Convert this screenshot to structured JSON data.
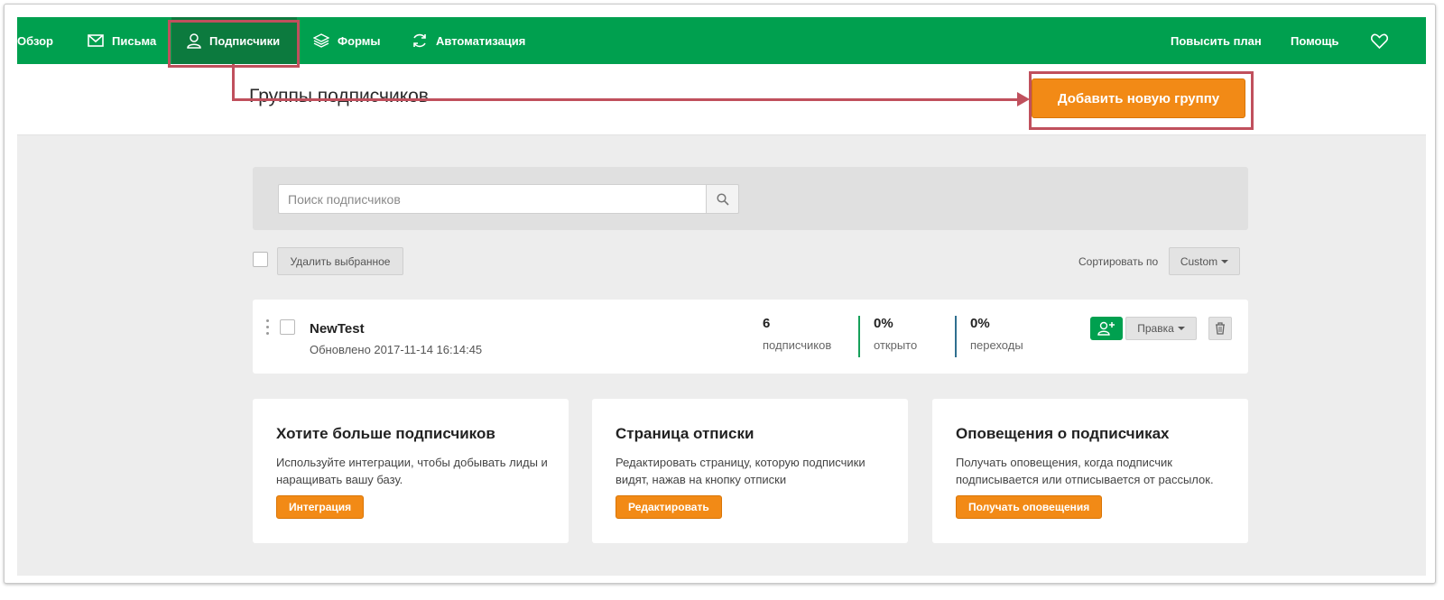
{
  "nav": {
    "overview": "Обзор",
    "letters": "Письма",
    "subscribers": "Подписчики",
    "forms": "Формы",
    "automation": "Автоматизация",
    "upgrade": "Повысить план",
    "help": "Помощь",
    "icons": [
      "mail-icon",
      "user-icon",
      "layers-icon",
      "refresh-icon",
      "heart-icon"
    ]
  },
  "header": {
    "title": "Группы подписчиков",
    "add_group": "Добавить новую группу"
  },
  "search": {
    "placeholder": "Поиск подписчиков"
  },
  "toolbar": {
    "delete_selected": "Удалить выбранное",
    "sort_label": "Сортировать по",
    "sort_value": "Custom"
  },
  "group": {
    "name": "NewTest",
    "updated": "Обновлено 2017-11-14 16:14:45",
    "subscribers_count": "6",
    "subscribers_label": "подписчиков",
    "opened_value": "0%",
    "opened_label": "открыто",
    "clicks_value": "0%",
    "clicks_label": "переходы",
    "edit_label": "Правка"
  },
  "cards": [
    {
      "title": "Хотите больше подписчиков",
      "text": "Используйте интеграции, чтобы добывать лиды и наращивать вашу базу.",
      "button": "Интеграция"
    },
    {
      "title": "Страница отписки",
      "text": "Редактировать страницу, которую подписчики видят, нажав на кнопку отписки",
      "button": "Редактировать"
    },
    {
      "title": "Оповещения о подписчиках",
      "text": "Получать оповещения, когда подписчик подписывается или отписывается от рассылок.",
      "button": "Получать оповещения"
    }
  ],
  "colors": {
    "nav_green": "#00a04f",
    "nav_active": "#0c7a3e",
    "accent_orange": "#f28a16",
    "annotation_red": "#c0505d",
    "sep_green": "#16a05a",
    "sep_blue": "#2f6f8f"
  }
}
